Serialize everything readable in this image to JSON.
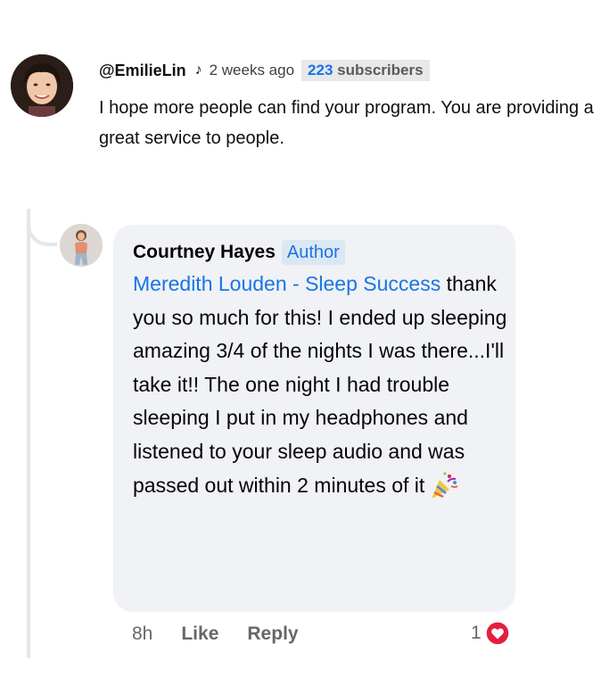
{
  "youtube_comment": {
    "username": "@EmilieLin",
    "note_icon": "♪",
    "time": "2 weeks ago",
    "subscriber_count": "223",
    "subscriber_label": "subscribers",
    "text": "I hope more people can find your program. You are providing a great service to people."
  },
  "reply": {
    "name": "Courtney Hayes",
    "badge": "Author",
    "mention": "Meredith Louden - Sleep Success",
    "text": "thank you so much for this! I ended up sleeping amazing 3/4 of the nights I was there...I'll take it!! The one night I had trouble sleeping I put in my headphones and listened to your sleep audio and was passed out within 2 minutes of it",
    "emoji": "party-popper-icon",
    "time": "8h",
    "like_label": "Like",
    "reply_label": "Reply",
    "reaction_count": "1",
    "reaction_icon": "heart-icon",
    "colors": {
      "link": "#1b74e4",
      "heart": "#e41e3f",
      "bubble": "#f0f2f5"
    }
  }
}
